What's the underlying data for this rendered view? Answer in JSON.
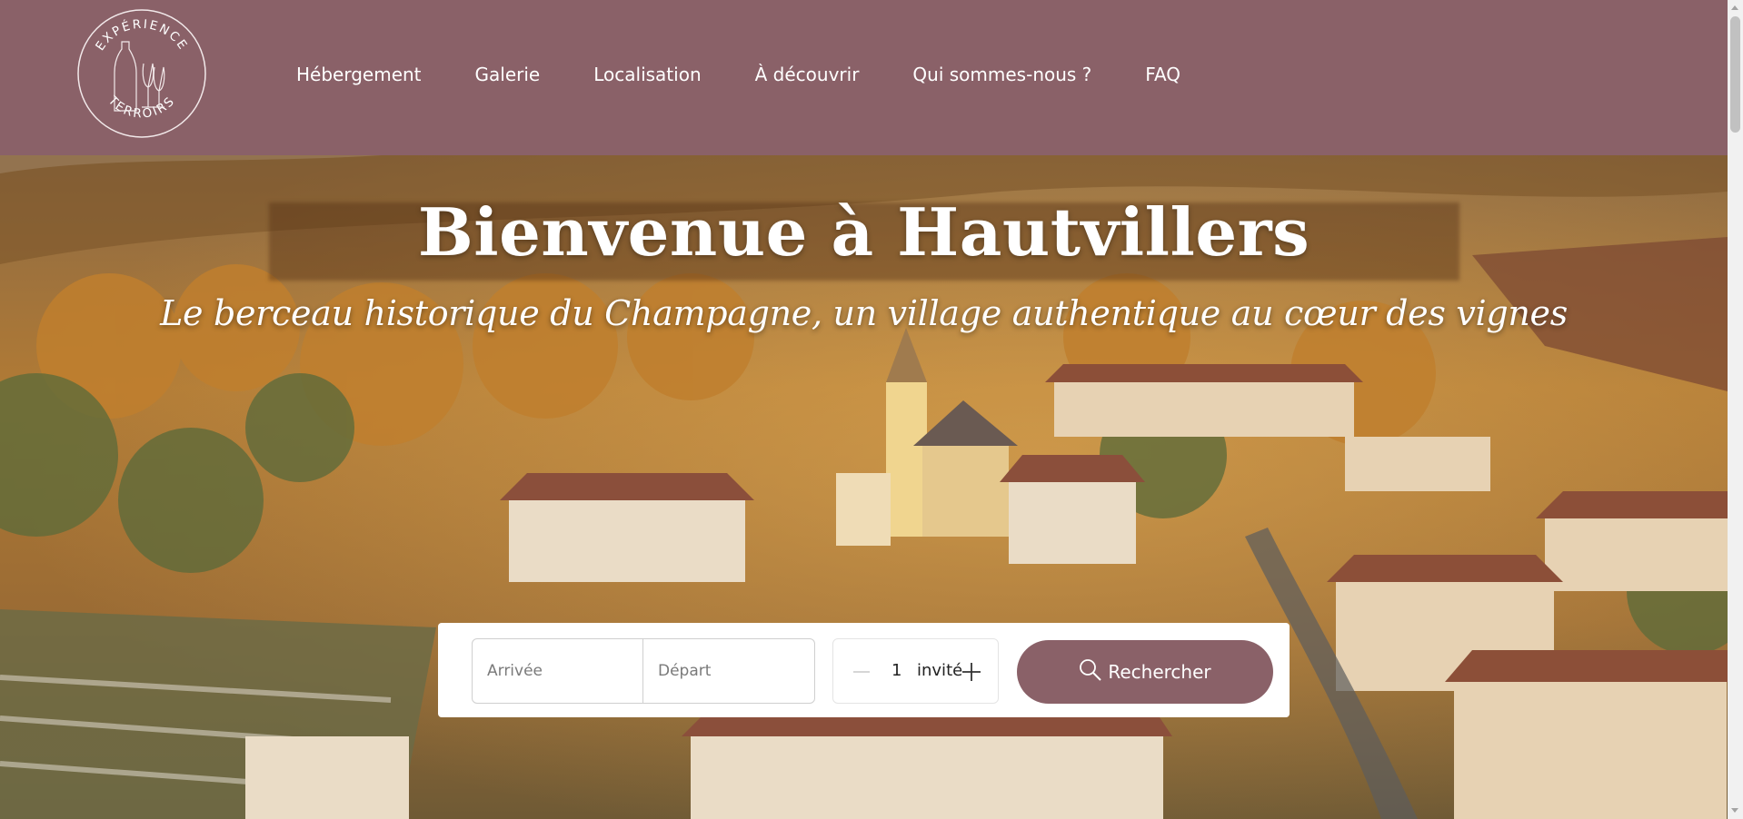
{
  "brand": {
    "logo_text_top": "EXPÉRIENCE",
    "logo_text_bottom": "TERROIRS",
    "color": "#8a6168"
  },
  "nav": {
    "items": [
      {
        "label": "Hébergement"
      },
      {
        "label": "Galerie"
      },
      {
        "label": "Localisation"
      },
      {
        "label": "À découvrir"
      },
      {
        "label": "Qui sommes-nous ?"
      },
      {
        "label": "FAQ"
      }
    ]
  },
  "hero": {
    "title": "Bienvenue à Hautvillers",
    "subtitle": "Le berceau historique du Champagne, un village authentique au cœur des vignes",
    "image": "aerial-village-vineyards"
  },
  "search": {
    "arrival_placeholder": "Arrivée",
    "departure_placeholder": "Départ",
    "guest_count": "1",
    "guest_label": "invité",
    "minus_icon": "minus-icon",
    "plus_icon": "plus-icon",
    "button_label": "Rechercher",
    "button_icon": "search-icon"
  }
}
